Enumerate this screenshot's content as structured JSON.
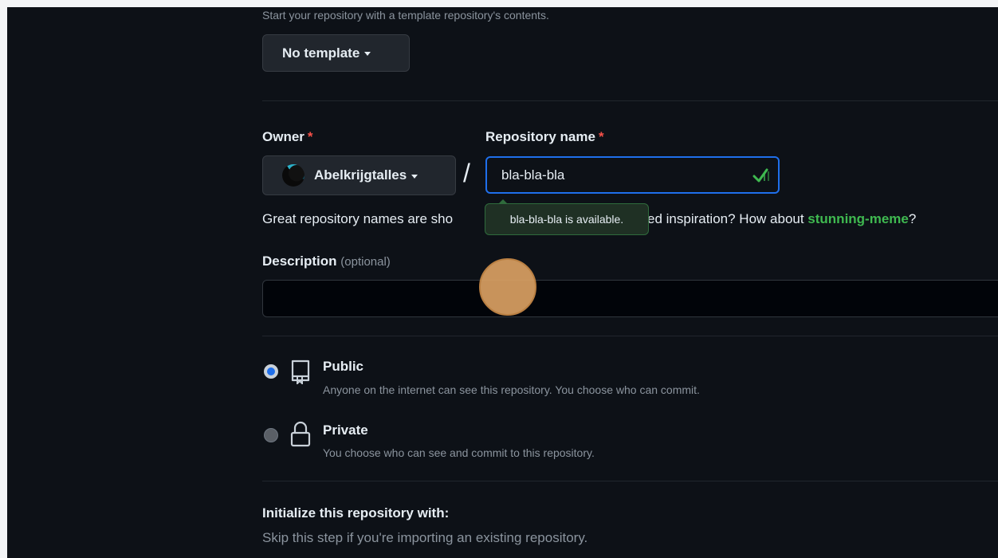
{
  "template": {
    "hint": "Start your repository with a template repository's contents.",
    "button_label": "No template"
  },
  "owner": {
    "label": "Owner",
    "required_mark": "*",
    "name": "Abelkrijgtalles"
  },
  "repo_name": {
    "label": "Repository name",
    "required_mark": "*",
    "value": "bla-bla-bla",
    "tooltip": "bla-bla-bla is available."
  },
  "separator": "/",
  "suggestion": {
    "text_before": "Great repository names are sho",
    "text_after": "ed inspiration? How about ",
    "suggested_name": "stunning-meme",
    "text_end": "?"
  },
  "description": {
    "label": "Description",
    "optional": "(optional)",
    "value": ""
  },
  "visibility": {
    "selected": "public",
    "public_title": "Public",
    "public_desc": "Anyone on the internet can see this repository. You choose who can commit.",
    "private_title": "Private",
    "private_desc": "You choose who can see and commit to this repository."
  },
  "initialize": {
    "heading": "Initialize this repository with:",
    "hint": "Skip this step if you're importing an existing repository."
  },
  "colors": {
    "background": "#0d1117",
    "accent_blue": "#1f6feb",
    "success_green": "#3fb950",
    "required_red": "#f85149",
    "tooltip_bg": "#1f3024",
    "cursor_highlight": "#e8a75c"
  },
  "icons": {
    "caret": "caret-down-icon",
    "avatar": "owner-avatar",
    "check": "check-icon",
    "repo": "repo-icon",
    "lock": "lock-icon"
  }
}
